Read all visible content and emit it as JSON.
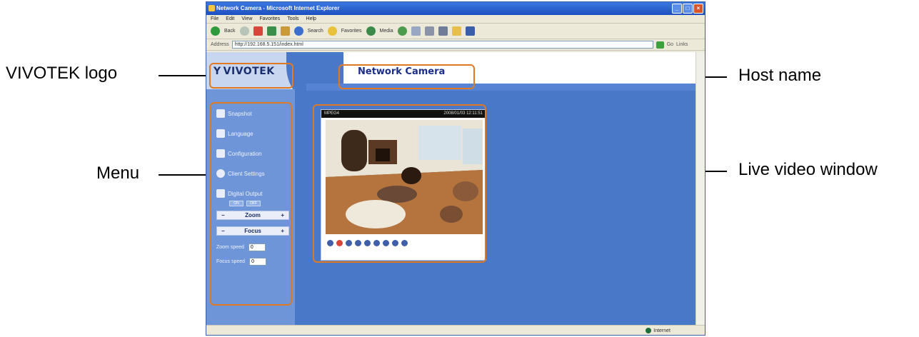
{
  "callouts": {
    "logo": "VIVOTEK logo",
    "host": "Host name",
    "menu": "Menu",
    "video": "Live video window"
  },
  "browser": {
    "title": "Network Camera - Microsoft Internet Explorer",
    "menu": [
      "File",
      "Edit",
      "View",
      "Favorites",
      "Tools",
      "Help"
    ],
    "toolbar": {
      "back": "Back",
      "search": "Search",
      "favorites": "Favorites",
      "media": "Media"
    },
    "address_label": "Address",
    "address_value": "http://192.168.5.151/index.html",
    "go_label": "Go",
    "links_label": "Links",
    "status_zone": "Internet"
  },
  "page": {
    "logo_text": "VIVOTEK",
    "hostname": "Network Camera",
    "menu": {
      "snapshot": "Snapshot",
      "language": "Language",
      "configuration": "Configuration",
      "client_settings": "Client Settings",
      "digital_output": "Digital Output",
      "do_on": "ON",
      "do_off": "OFF",
      "zoom": "Zoom",
      "focus": "Focus",
      "zoom_speed_label": "Zoom speed",
      "zoom_speed_value": "0",
      "focus_speed_label": "Focus speed",
      "focus_speed_value": "0"
    },
    "video": {
      "codec": "MPEG4",
      "timestamp": "2008/01/03 12:11:51"
    }
  },
  "colors": {
    "highlight": "#e07a22",
    "page_bg": "#4a78c8",
    "sidebar": "#6e95d8",
    "hostname_text": "#1b2e8a"
  }
}
